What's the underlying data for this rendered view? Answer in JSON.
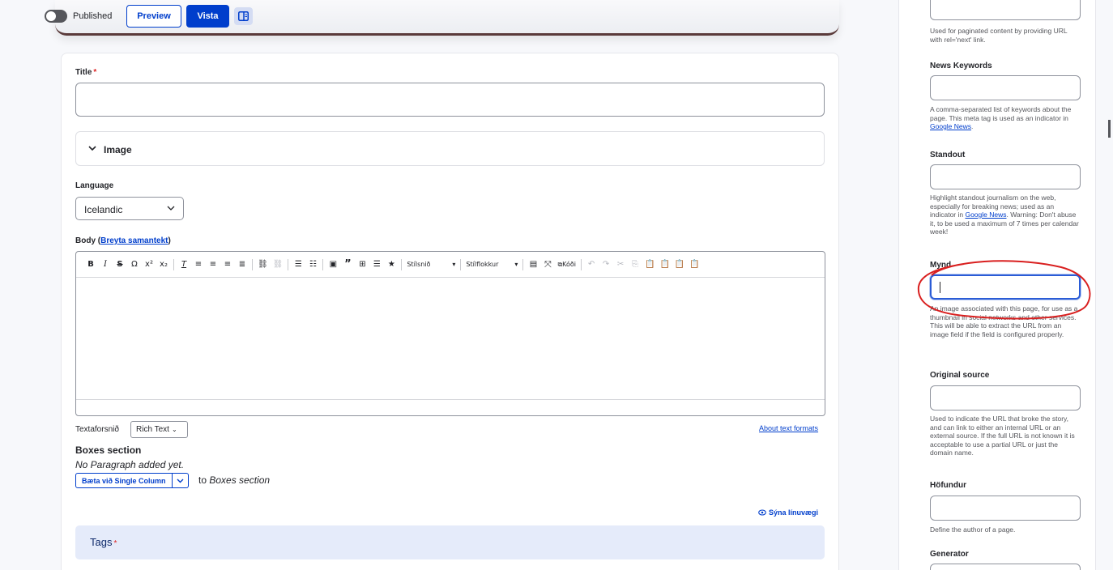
{
  "topbar": {
    "published_label": "Published",
    "preview_label": "Preview",
    "save_label": "Vista",
    "sidebar_toggle_icon": "sidebar-panel-icon"
  },
  "form": {
    "title_label": "Title",
    "required_mark": "*",
    "image_summary": "Image",
    "language_label": "Language",
    "language_value": "Icelandic",
    "body_label_prefix": "Body (",
    "body_summary_link": "Breyta samantekt",
    "body_label_suffix": ")",
    "toolbar": {
      "style_dropdown": "Stílsnið",
      "format_dropdown": "Stílflokkur",
      "source_label": "Kóði"
    },
    "text_format_label": "Textaforsnið",
    "text_format_value": "Rich Text",
    "about_formats_link": "About text formats",
    "boxes_title": "Boxes section",
    "no_paragraph": "No Paragraph added yet.",
    "add_button": "Bæta við Single Column",
    "add_to_prefix": "to ",
    "add_to_target": "Boxes section",
    "show_weights": "Sýna línuvægi",
    "tags_label": "Tags"
  },
  "sidebar": {
    "next_desc": "Used for paginated content by providing URL with rel='next' link.",
    "news_keywords_label": "News Keywords",
    "news_keywords_desc_pre": "A comma-separated list of keywords about the page. This meta tag is used as an indicator in ",
    "google_news_link": "Google News",
    "desc_period": ".",
    "standout_label": "Standout",
    "standout_desc_pre": "Highlight standout journalism on the web, especially for breaking news; used as an indicator in ",
    "standout_desc_post": ". Warning: Don't abuse it, to be used a maximum of 7 times per calendar week!",
    "mynd_label": "Mynd",
    "mynd_desc": "An image associated with this page, for use as a thumbnail in social networks and other services. This will be able to extract the URL from an image field if the field is configured properly.",
    "original_source_label": "Original source",
    "original_source_desc": "Used to indicate the URL that broke the story, and can link to either an internal URL or an external source. If the full URL is not known it is acceptable to use a partial URL or just the domain name.",
    "author_label": "Höfundur",
    "author_desc": "Define the author of a page.",
    "generator_label": "Generator"
  },
  "colors": {
    "primary": "#003ecc",
    "required": "#dc2323",
    "annotation": "#d91f1f"
  }
}
